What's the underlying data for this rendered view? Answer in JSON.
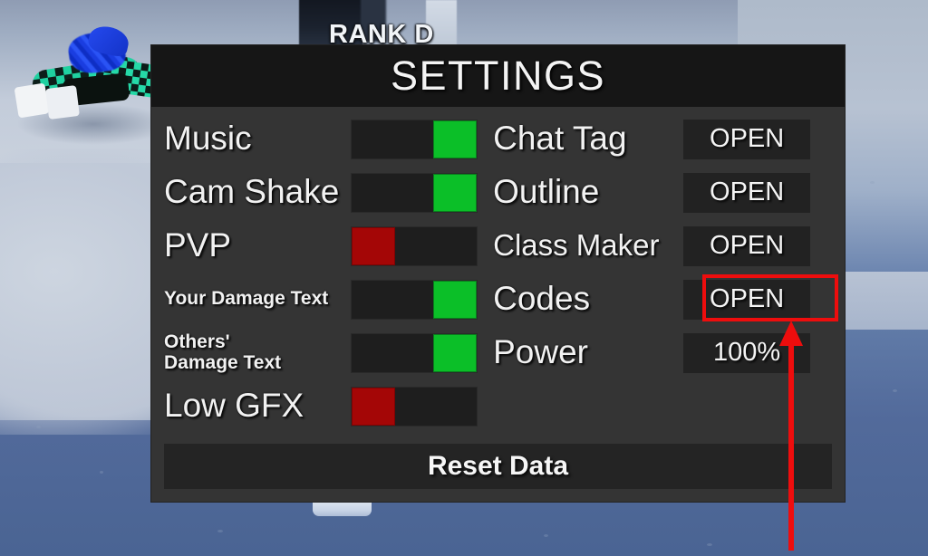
{
  "background": {
    "rank_text": "RANK D",
    "scene_description": "snow-ground",
    "ground_color": "#b9c3d4",
    "ground_shadow_color": "#4c6694"
  },
  "panel": {
    "title": "SETTINGS",
    "header_bg": "#161616",
    "body_bg": "#343434",
    "left_column": [
      {
        "label": "Music",
        "size": "big",
        "toggle": "on",
        "state_color": "#0bbf28"
      },
      {
        "label": "Cam Shake",
        "size": "big",
        "toggle": "on",
        "state_color": "#0bbf28"
      },
      {
        "label": "PVP",
        "size": "big",
        "toggle": "off",
        "state_color": "#a40606"
      },
      {
        "label": "Your Damage Text",
        "size": "sm",
        "toggle": "on",
        "state_color": "#0bbf28"
      },
      {
        "label": "Others' Damage Text",
        "size": "sm",
        "toggle": "on",
        "state_color": "#0bbf28"
      },
      {
        "label": "Low GFX",
        "size": "big",
        "toggle": "off",
        "state_color": "#a40606"
      }
    ],
    "right_column": [
      {
        "label": "Chat Tag",
        "size": "big",
        "value": "OPEN"
      },
      {
        "label": "Outline",
        "size": "big",
        "value": "OPEN"
      },
      {
        "label": "Class Maker",
        "size": "mid",
        "value": "OPEN"
      },
      {
        "label": "Codes",
        "size": "big",
        "value": "OPEN"
      },
      {
        "label": "Power",
        "size": "big",
        "value": "100%"
      }
    ],
    "reset_button": "Reset Data"
  },
  "annotation": {
    "highlight_color": "#ee0d0d",
    "highlight_target": "Codes OPEN button",
    "arrow_color": "#ee0d0d"
  }
}
